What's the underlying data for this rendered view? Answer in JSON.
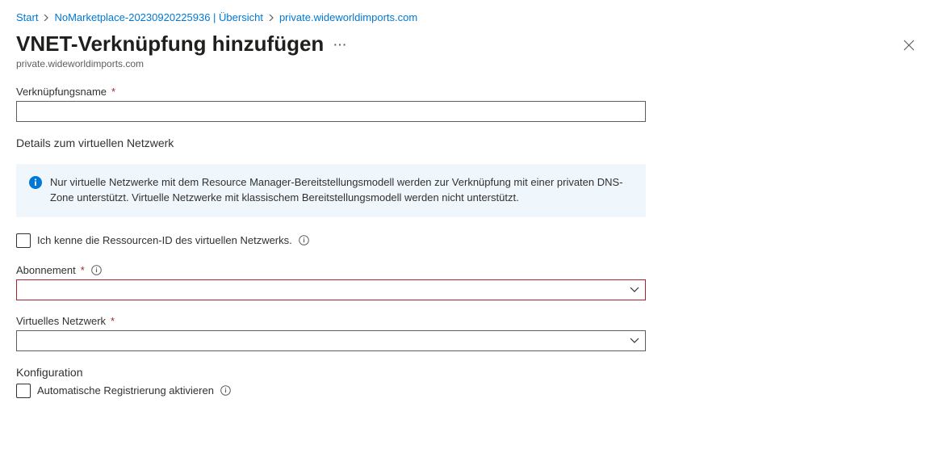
{
  "breadcrumb": {
    "items": [
      {
        "label": "Start"
      },
      {
        "label": "NoMarketplace-20230920225936 | Übersicht"
      },
      {
        "label": "private.wideworldimports.com"
      }
    ]
  },
  "header": {
    "title": "VNET-Verknüpfung hinzufügen",
    "subtitle": "private.wideworldimports.com",
    "ellipsis": "···"
  },
  "form": {
    "link_name_label": "Verknüpfungsname",
    "link_name_value": "",
    "vnet_details_heading": "Details zum virtuellen Netzwerk",
    "info_message": "Nur virtuelle Netzwerke mit dem Resource Manager-Bereitstellungsmodell werden zur Verknüpfung mit einer privaten DNS-Zone unterstützt. Virtuelle Netzwerke mit klassischem Bereitstellungsmodell werden nicht unterstützt.",
    "know_resource_id_label": "Ich kenne die Ressourcen-ID des virtuellen Netzwerks.",
    "subscription_label": "Abonnement",
    "subscription_value": "",
    "vnet_label": "Virtuelles Netzwerk",
    "vnet_value": "",
    "config_heading": "Konfiguration",
    "auto_register_label": "Automatische Registrierung aktivieren"
  },
  "icons": {
    "info_color": "#0078d4",
    "required_color": "#a4262c"
  }
}
